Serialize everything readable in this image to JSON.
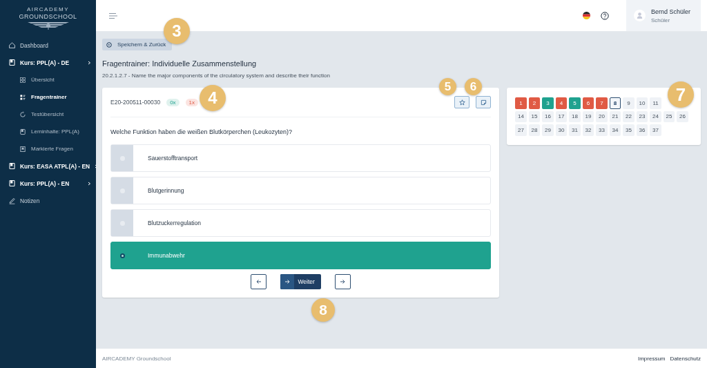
{
  "sidebar": {
    "logo": {
      "line1": "AIRCADEMY",
      "line2": "GROUNDSCHOOL"
    },
    "items": [
      {
        "label": "Dashboard",
        "kind": "home"
      },
      {
        "label": "Kurs: PPL(A) - DE",
        "kind": "course",
        "children": [
          {
            "label": "Übersicht",
            "selected": false
          },
          {
            "label": "Fragentrainer",
            "selected": true
          },
          {
            "label": "Testübersicht",
            "selected": false
          },
          {
            "label": "Lerninhalte: PPL(A)",
            "selected": false
          },
          {
            "label": "Markierte Fragen",
            "selected": false
          }
        ]
      },
      {
        "label": "Kurs: EASA ATPL(A) - EN",
        "kind": "course"
      },
      {
        "label": "Kurs: PPL(A) - EN",
        "kind": "course"
      },
      {
        "label": "Notizen",
        "kind": "notes"
      }
    ]
  },
  "header": {
    "user": {
      "name": "Bernd Schüler",
      "role": "Schüler"
    }
  },
  "back_button": "Speichern & Zurück",
  "title": "Fragentrainer: Individuelle Zusammenstellung",
  "subtitle": "20.2.1.2.7 - Name the major components of the circulatory system and describe their function",
  "question": {
    "id": "E20-200511-00030",
    "counters": [
      {
        "label": "0x",
        "kind": "correct"
      },
      {
        "label": "1x",
        "kind": "wrong"
      }
    ],
    "text": "Welche Funktion haben die weißen Blutkörperchen (Leukozyten)?",
    "answers": [
      {
        "label": "Sauerstofftransport",
        "selected": false
      },
      {
        "label": "Blutgerinnung",
        "selected": false
      },
      {
        "label": "Blutzuckerregulation",
        "selected": false
      },
      {
        "label": "Immunabwehr",
        "selected": true
      }
    ],
    "next_button": "Weiter"
  },
  "question_grid": [
    [
      {
        "label": "1",
        "color": "#e05a44",
        "current": false
      },
      {
        "label": "2",
        "color": "#e05a44",
        "current": false
      },
      {
        "label": "3",
        "color": "#1fa28f",
        "current": false
      },
      {
        "label": "4",
        "color": "#e05a44",
        "current": false
      },
      {
        "label": "5",
        "color": "#1fa28f",
        "current": false
      },
      {
        "label": "6",
        "color": "#e05a44",
        "current": false
      },
      {
        "label": "7",
        "color": "#e05a44",
        "current": false
      },
      {
        "label": "8",
        "color": "#f3f6fa",
        "current": true
      },
      {
        "label": "9",
        "color": "#eff2f6",
        "current": false
      },
      {
        "label": "10",
        "color": "#eff2f6",
        "current": false
      },
      {
        "label": "11",
        "color": "#eff2f6",
        "current": false
      }
    ],
    [
      {
        "label": "14",
        "color": "#eff2f6",
        "current": false
      },
      {
        "label": "15",
        "color": "#eff2f6",
        "current": false
      },
      {
        "label": "16",
        "color": "#eff2f6",
        "current": false
      },
      {
        "label": "17",
        "color": "#eff2f6",
        "current": false
      },
      {
        "label": "18",
        "color": "#eff2f6",
        "current": false
      },
      {
        "label": "19",
        "color": "#eff2f6",
        "current": false
      },
      {
        "label": "20",
        "color": "#eff2f6",
        "current": false
      },
      {
        "label": "21",
        "color": "#eff2f6",
        "current": false
      },
      {
        "label": "22",
        "color": "#eff2f6",
        "current": false
      },
      {
        "label": "23",
        "color": "#eff2f6",
        "current": false
      },
      {
        "label": "24",
        "color": "#eff2f6",
        "current": false
      },
      {
        "label": "25",
        "color": "#eff2f6",
        "current": false
      },
      {
        "label": "26",
        "color": "#eff2f6",
        "current": false
      }
    ],
    [
      {
        "label": "27",
        "color": "#eff2f6",
        "current": false
      },
      {
        "label": "28",
        "color": "#eff2f6",
        "current": false
      },
      {
        "label": "29",
        "color": "#eff2f6",
        "current": false
      },
      {
        "label": "30",
        "color": "#eff2f6",
        "current": false
      },
      {
        "label": "31",
        "color": "#eff2f6",
        "current": false
      },
      {
        "label": "32",
        "color": "#eff2f6",
        "current": false
      },
      {
        "label": "33",
        "color": "#eff2f6",
        "current": false
      },
      {
        "label": "34",
        "color": "#eff2f6",
        "current": false
      },
      {
        "label": "35",
        "color": "#eff2f6",
        "current": false
      },
      {
        "label": "36",
        "color": "#eff2f6",
        "current": false
      },
      {
        "label": "37",
        "color": "#eff2f6",
        "current": false
      }
    ]
  ],
  "footer": {
    "brand": "AIRCADEMY Groundschool",
    "links": [
      "Impressum",
      "Datenschutz"
    ]
  },
  "callouts": [
    {
      "label": "3"
    },
    {
      "label": "4"
    },
    {
      "label": "5"
    },
    {
      "label": "6"
    },
    {
      "label": "7"
    },
    {
      "label": "8"
    }
  ]
}
